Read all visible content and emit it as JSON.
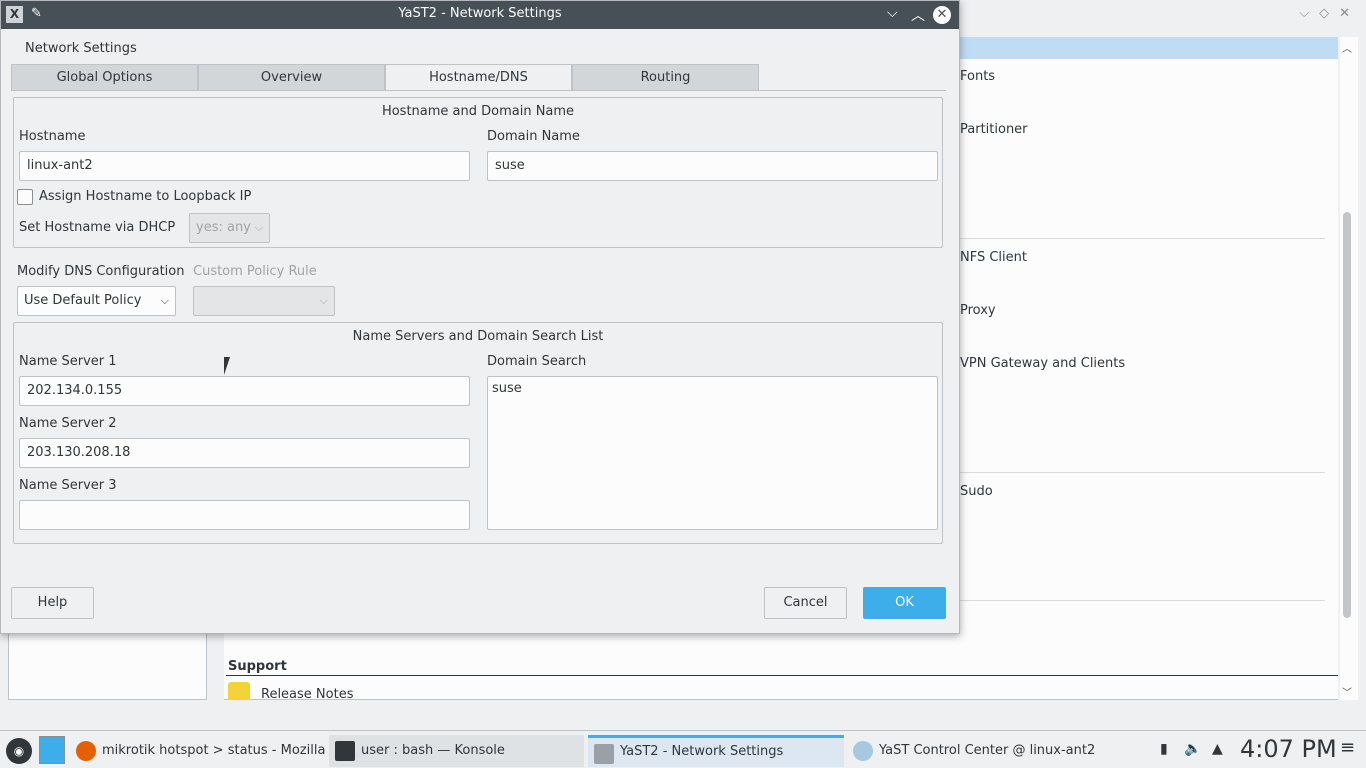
{
  "background_window": {
    "items": [
      "Fonts",
      "Partitioner",
      "NFS Client",
      "Proxy",
      "VPN Gateway and Clients",
      "Sudo"
    ],
    "support_heading": "Support",
    "release_notes": "Release Notes"
  },
  "dialog": {
    "title": "YaST2 - Network Settings",
    "heading": "Network Settings",
    "tabs": [
      "Global Options",
      "Overview",
      "Hostname/DNS",
      "Routing"
    ],
    "active_tab": "Hostname/DNS",
    "hostname_group": {
      "title": "Hostname and Domain Name",
      "hostname_label": "Hostname",
      "hostname_value": "linux-ant2",
      "domain_label": "Domain Name",
      "domain_value": "suse",
      "loopback_label": "Assign Hostname to Loopback IP",
      "loopback_checked": false,
      "dhcp_label": "Set Hostname via DHCP",
      "dhcp_value": "yes: any"
    },
    "dns": {
      "modify_label": "Modify DNS Configuration",
      "modify_value": "Use Default Policy",
      "custom_policy_label": "Custom Policy Rule",
      "custom_policy_value": ""
    },
    "nameservers_group": {
      "title": "Name Servers and Domain Search List",
      "ns1_label": "Name Server 1",
      "ns1_value": "202.134.0.155",
      "ns2_label": "Name Server 2",
      "ns2_value": "203.130.208.18",
      "ns3_label": "Name Server 3",
      "ns3_value": "",
      "search_label": "Domain Search",
      "search_value": "suse"
    },
    "buttons": {
      "help": "Help",
      "cancel": "Cancel",
      "ok": "OK"
    }
  },
  "taskbar": {
    "tasks": [
      "mikrotik hotspot > status - Mozilla ...",
      "user : bash — Konsole",
      "YaST2 - Network Settings",
      "YaST Control Center @ linux-ant2"
    ],
    "clock": "4:07 PM"
  },
  "colors": {
    "accent": "#3daee9",
    "titlebar": "#475057"
  }
}
